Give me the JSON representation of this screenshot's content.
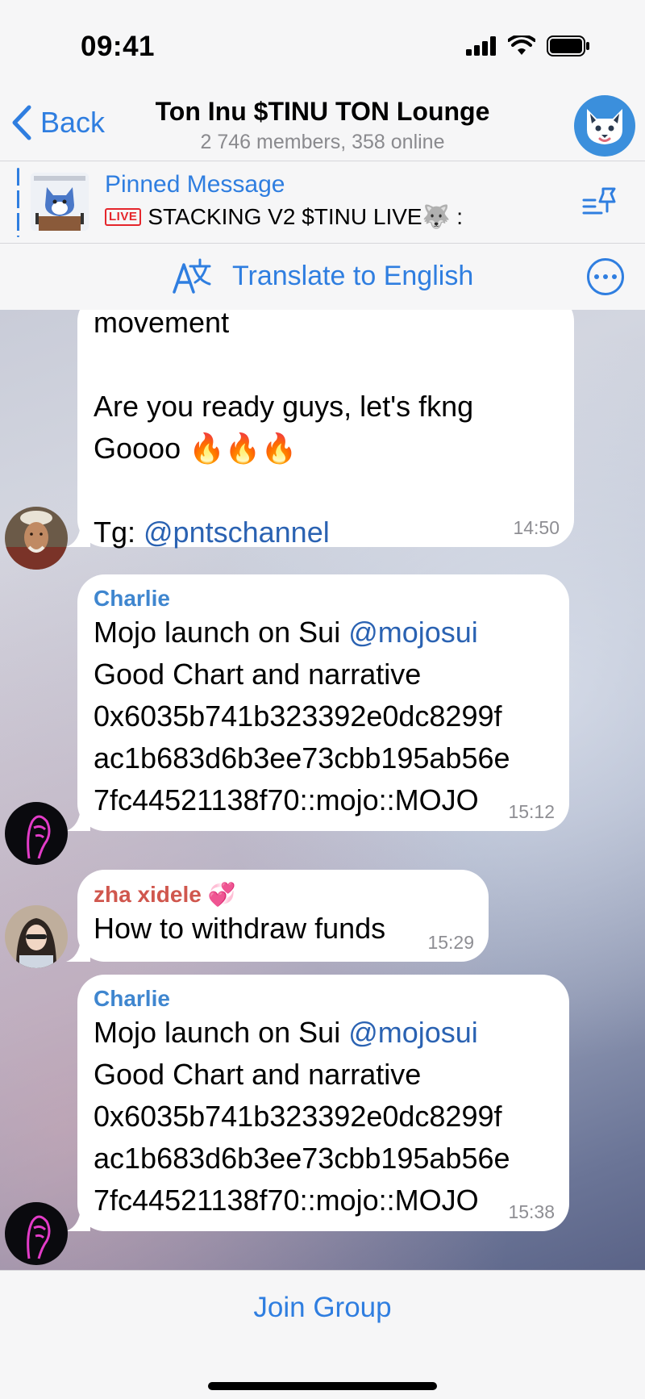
{
  "status_bar": {
    "time": "09:41"
  },
  "nav": {
    "back_label": "Back",
    "title": "Ton Inu $TINU TON Lounge",
    "subtitle": "2 746 members, 358 online"
  },
  "pinned": {
    "label": "Pinned Message",
    "badge": "LIVE",
    "text": "STACKING V2 $TINU LIVE🐺 :"
  },
  "translate": {
    "label": "Translate to English"
  },
  "messages": [
    {
      "sender": "",
      "body_before": "movement\n\nAre you ready guys, let's fkng Goooo 🔥🔥🔥\n\nTg: ",
      "mention": "@pntschannel",
      "time": "14:50"
    },
    {
      "sender": "Charlie",
      "line1_before": "Mojo launch on Sui ",
      "mention": "@mojosui",
      "body_after": "Good Chart and narrative\n0x6035b741b323392e0dc8299f\nac1b683d6b3ee73cbb195ab56e\n7fc44521138f70::mojo::MOJO",
      "time": "15:12"
    },
    {
      "sender": "zha xidele",
      "sender_emoji": "💞",
      "body": "How to withdraw funds",
      "time": "15:29"
    },
    {
      "sender": "Charlie",
      "line1_before": "Mojo launch on Sui ",
      "mention": "@mojosui",
      "body_after": "Good Chart and narrative\n0x6035b741b323392e0dc8299f\nac1b683d6b3ee73cbb195ab56e\n7fc44521138f70::mojo::MOJO",
      "time": "15:38"
    }
  ],
  "bottom": {
    "join_label": "Join Group"
  },
  "colors": {
    "accent": "#2f7ee0",
    "charlie": "#3f86cf",
    "zha": "#d0574e",
    "mention": "#2a62b2"
  }
}
